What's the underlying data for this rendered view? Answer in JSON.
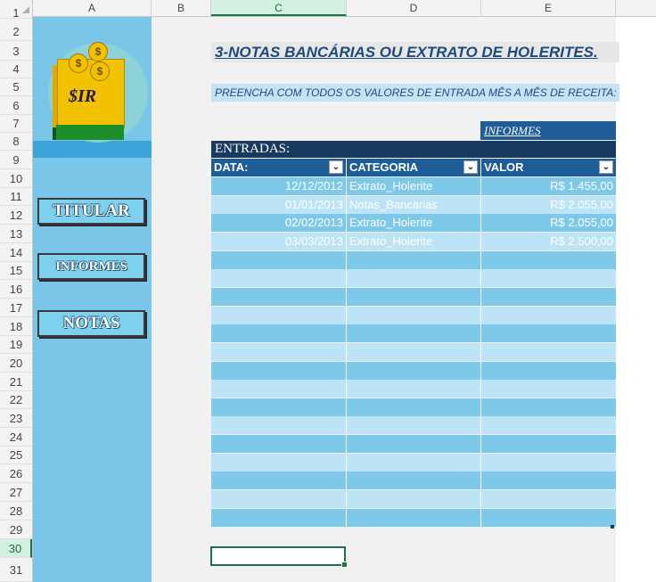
{
  "columns": [
    "A",
    "B",
    "C",
    "D",
    "E"
  ],
  "rows": [
    "1",
    "2",
    "3",
    "4",
    "5",
    "6",
    "7",
    "8",
    "9",
    "10",
    "11",
    "12",
    "13",
    "14",
    "15",
    "16",
    "17",
    "18",
    "19",
    "20",
    "21",
    "22",
    "23",
    "24",
    "25",
    "26",
    "27",
    "28",
    "29",
    "30",
    "31"
  ],
  "selected_column": "C",
  "selected_row": "30",
  "logo": {
    "label": "$IR",
    "coin_symbol": "$"
  },
  "sidebar": {
    "buttons": [
      {
        "label": "TITULAR"
      },
      {
        "label": "INFORMES"
      },
      {
        "label": "NOTAS"
      }
    ]
  },
  "page": {
    "title": "3-NOTAS BANCÁRIAS OU EXTRATO DE HOLERITES.",
    "subtitle": "PREENCHA COM TODOS OS VALORES DE ENTRADA MÊS A MÊS DE RECEITA:",
    "informes_link": "INFORMES"
  },
  "table": {
    "title": "ENTRADAS:",
    "headers": [
      "DATA:",
      "CATEGORIA",
      "VALOR"
    ],
    "rows": [
      [
        "12/12/2012",
        "Extrato_Holerite",
        "R$ 1.455,00"
      ],
      [
        "01/01/2013",
        "Notas_Bancarias",
        "R$ 2.055,00"
      ],
      [
        "02/02/2013",
        "Extrato_Holerite",
        "R$ 2.055,00"
      ],
      [
        "03/03/2013",
        "Extrato_Holerite",
        "R$ 2.500,00"
      ]
    ],
    "empty_rows": 15
  },
  "colors": {
    "row_dark": "#7ec8ea",
    "row_light": "#bde3f6",
    "header": "#1f5d99",
    "title_bar": "#173a5e",
    "sidebar": "#79c6e8"
  }
}
